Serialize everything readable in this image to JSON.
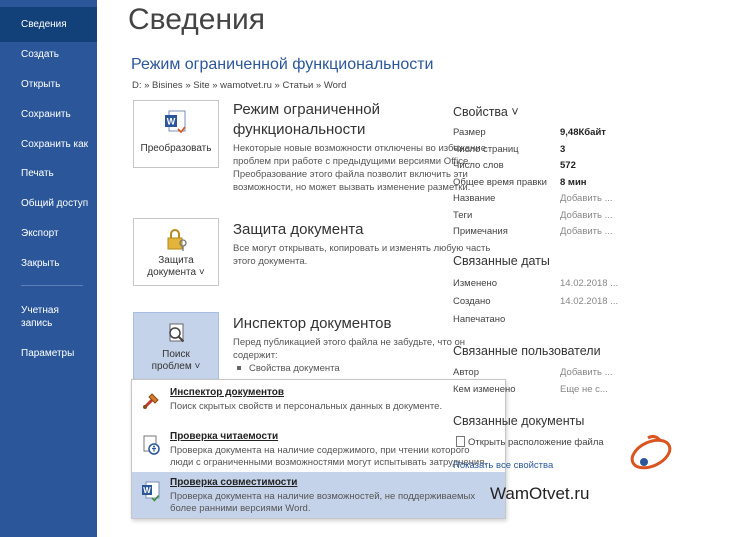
{
  "nav": {
    "items": [
      {
        "label": "Сведения"
      },
      {
        "label": "Создать"
      },
      {
        "label": "Открыть"
      },
      {
        "label": "Сохранить"
      },
      {
        "label": "Сохранить как"
      },
      {
        "label": "Печать"
      },
      {
        "label": "Общий доступ"
      },
      {
        "label": "Экспорт"
      },
      {
        "label": "Закрыть"
      },
      {
        "label": "Учетная\nзапись"
      },
      {
        "label": "Параметры"
      }
    ]
  },
  "main": {
    "title": "Сведения",
    "subtitle": "Режим ограниченной функциональности",
    "path": "D: » Bisines » Site » wamotvet.ru » Статьи » Word",
    "sections": [
      {
        "button_label": "Преобразовать",
        "title": "Режим ограниченной\nфункциональности",
        "desc": "Некоторые новые возможности отключены во избежание\nпроблем при работе с предыдущими версиями Office.\nПреобразование этого файла позволит включить эти\nвозможности, но может вызвать изменение разметки."
      },
      {
        "button_label": "Защита\nдокумента ˅",
        "title": "Защита документа",
        "desc": "Все могут открывать, копировать и изменять любую часть\nэтого документа."
      },
      {
        "button_label": "Поиск\nпроблем ˅",
        "title": "Инспектор документов",
        "desc": "Перед публикацией этого файла не забудьте, что он\nсодержит:",
        "bullet": "Свойства документа"
      }
    ]
  },
  "dropdown": {
    "items": [
      {
        "title": "Инспектор документов",
        "desc": "Поиск скрытых свойств и персональных данных в документе."
      },
      {
        "title": "Проверка читаемости",
        "desc": "Проверка документа на наличие содержимого, при чтении которого\nлюди с ограниченными возможностями могут испытывать затруднения."
      },
      {
        "title": "Проверка совместимости",
        "desc": "Проверка документа на наличие возможностей, не поддерживаемых\nболее ранними версиями Word."
      }
    ]
  },
  "properties": {
    "heading": "Свойства ˅",
    "rows": [
      {
        "label": "Размер",
        "value": "9,48Кбайт"
      },
      {
        "label": "Число страниц",
        "value": "3"
      },
      {
        "label": "Число слов",
        "value": "572"
      },
      {
        "label": "Общее время правки",
        "value": "8 мин"
      },
      {
        "label": "Название",
        "value": "Добавить ..."
      },
      {
        "label": "Теги",
        "value": "Добавить ..."
      },
      {
        "label": "Примечания",
        "value": "Добавить ..."
      }
    ]
  },
  "dates": {
    "heading": "Связанные даты",
    "rows": [
      {
        "label": "Изменено",
        "value": "14.02.2018 ..."
      },
      {
        "label": "Создано",
        "value": "14.02.2018 ..."
      },
      {
        "label": "Напечатано",
        "value": ""
      }
    ]
  },
  "people": {
    "heading": "Связанные пользователи",
    "rows": [
      {
        "label": "Автор",
        "value": "Добавить ..."
      },
      {
        "label": "Кем изменено",
        "value": "Еще не с..."
      }
    ]
  },
  "docs": {
    "heading": "Связанные документы",
    "open_location": "Открыть расположение файла",
    "show_all": "Показать все свойства"
  },
  "watermark": "WamOtvet.ru"
}
